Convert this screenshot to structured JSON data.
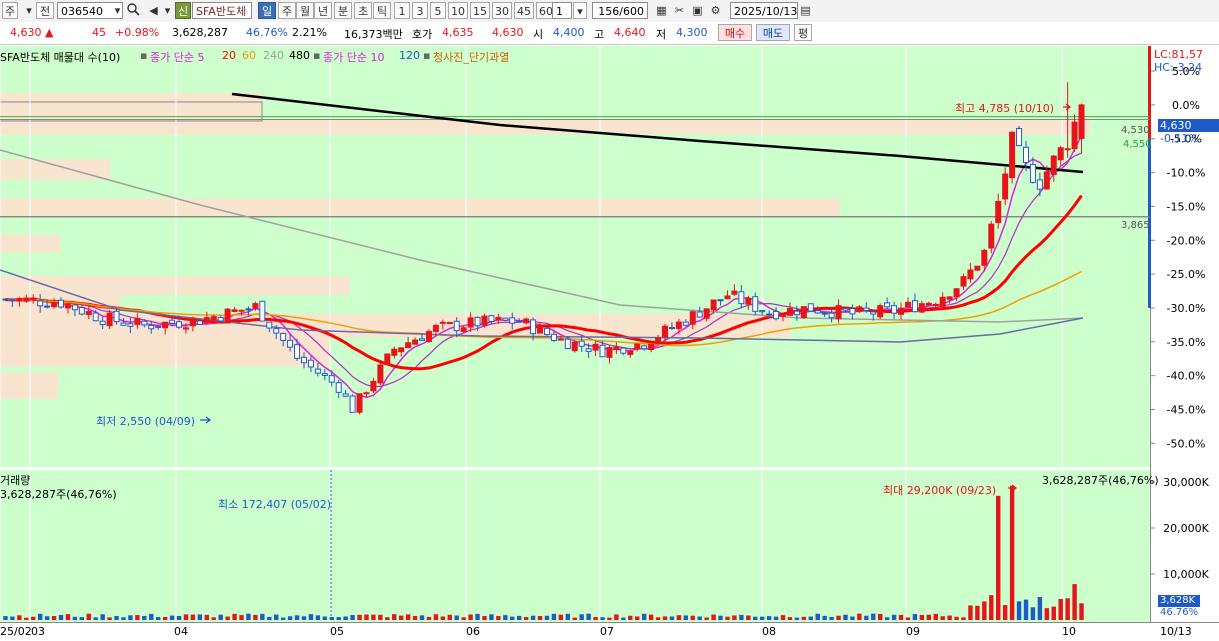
{
  "toolbar": {
    "market_label": "주",
    "prev_label": "전",
    "code_value": "036540",
    "new_badge": "신",
    "stock_name": "SFA반도체",
    "periods": [
      "일",
      "주",
      "월",
      "년",
      "분",
      "초",
      "틱"
    ],
    "active_period": "일",
    "intervals": [
      "1",
      "3",
      "5",
      "10",
      "15",
      "30",
      "45",
      "60"
    ],
    "unit_value": "1",
    "count_display": "156/600",
    "date_value": "2025/10/13"
  },
  "quote": {
    "price": "4,630",
    "change_arrow": "▲",
    "change": "45",
    "change_pct": "+0.98%",
    "volume": "3,628,287",
    "volume_ratio": "46.76%",
    "turnover": "2.21%",
    "amount": "16,373백만",
    "hoga_label": "호가",
    "ask": "4,635",
    "bid": "4,630",
    "open_label": "시",
    "open": "4,400",
    "high_label": "고",
    "high": "4,640",
    "low_label": "저",
    "low": "4,300",
    "buy_button": "매수",
    "sell_button": "매도",
    "eval_button": "평"
  },
  "legend": {
    "main_series": "SFA반도체 매물대 수(10)",
    "ma_label": "종가 단순 5",
    "ma_p2": "20",
    "ma_p3": "60",
    "ma_p4": "240",
    "ma_p5": "480",
    "vol_ma_label": "종가 단순 10",
    "vol_ma_p2": "120",
    "signal_label": "청사진_단기과열",
    "volume_title": "거래량",
    "volume_value": "3,628,287주(46,76%)",
    "volume_value_right": "3,628,287주(46,76%)"
  },
  "annotations": {
    "high": "최고 4,785 (10/10)",
    "low": "최저 2,550 (04/09)",
    "vol_max": "최대 29,200K (09/23)",
    "vol_min": "최소 172,407 (05/02)"
  },
  "right_axis": {
    "lc": "LC:81,57",
    "hc": "HC:-3,24",
    "current_price": "4,630",
    "current_pct": "-0,11%",
    "level_a": "4,530",
    "level_b": "4,550",
    "level_c": "3,865",
    "pct_ticks": [
      "5.0%",
      "0.0%",
      "-5.0%",
      "-10.0%",
      "-15.0%",
      "-20.0%",
      "-25.0%",
      "-30.0%",
      "-35.0%",
      "-40.0%",
      "-45.0%",
      "-50.0%"
    ],
    "vol_ticks": [
      "30,000K",
      "20,000K",
      "10,000K"
    ],
    "vol_current": "3,628K",
    "vol_current_pct": "46.76%"
  },
  "colors": {
    "chart_bg": "#ccffcc",
    "up": "#e8141b",
    "down": "#1f5bc8",
    "ma5": "#e020e0",
    "ma20": "#ff0000",
    "ma60": "#f0a000",
    "ma240": "#a0a0a0",
    "ma480": "#000000",
    "volume_profile": "#f9e4cf"
  },
  "chart_data": {
    "type": "candlestick",
    "x_labels": [
      "25/02",
      "03",
      "04",
      "05",
      "06",
      "07",
      "08",
      "09",
      "10",
      "10/13"
    ],
    "price_range": [
      2550,
      4785
    ],
    "pct_range": [
      -50,
      5
    ],
    "high": {
      "value": 4785,
      "date": "10/10"
    },
    "low": {
      "value": 2550,
      "date": "04/09"
    },
    "last_close": 4630,
    "reference_levels": [
      4530,
      4550,
      3865
    ],
    "ohlc_last": {
      "open": 4400,
      "high": 4640,
      "low": 4300,
      "close": 4630
    },
    "volume": {
      "max": {
        "value": 29200000,
        "date": "09/23"
      },
      "min": {
        "value": 172407,
        "date": "05/02"
      },
      "last": 3628287,
      "ylim": [
        0,
        30000000
      ]
    },
    "moving_averages": [
      5,
      20,
      60,
      240,
      480
    ]
  }
}
